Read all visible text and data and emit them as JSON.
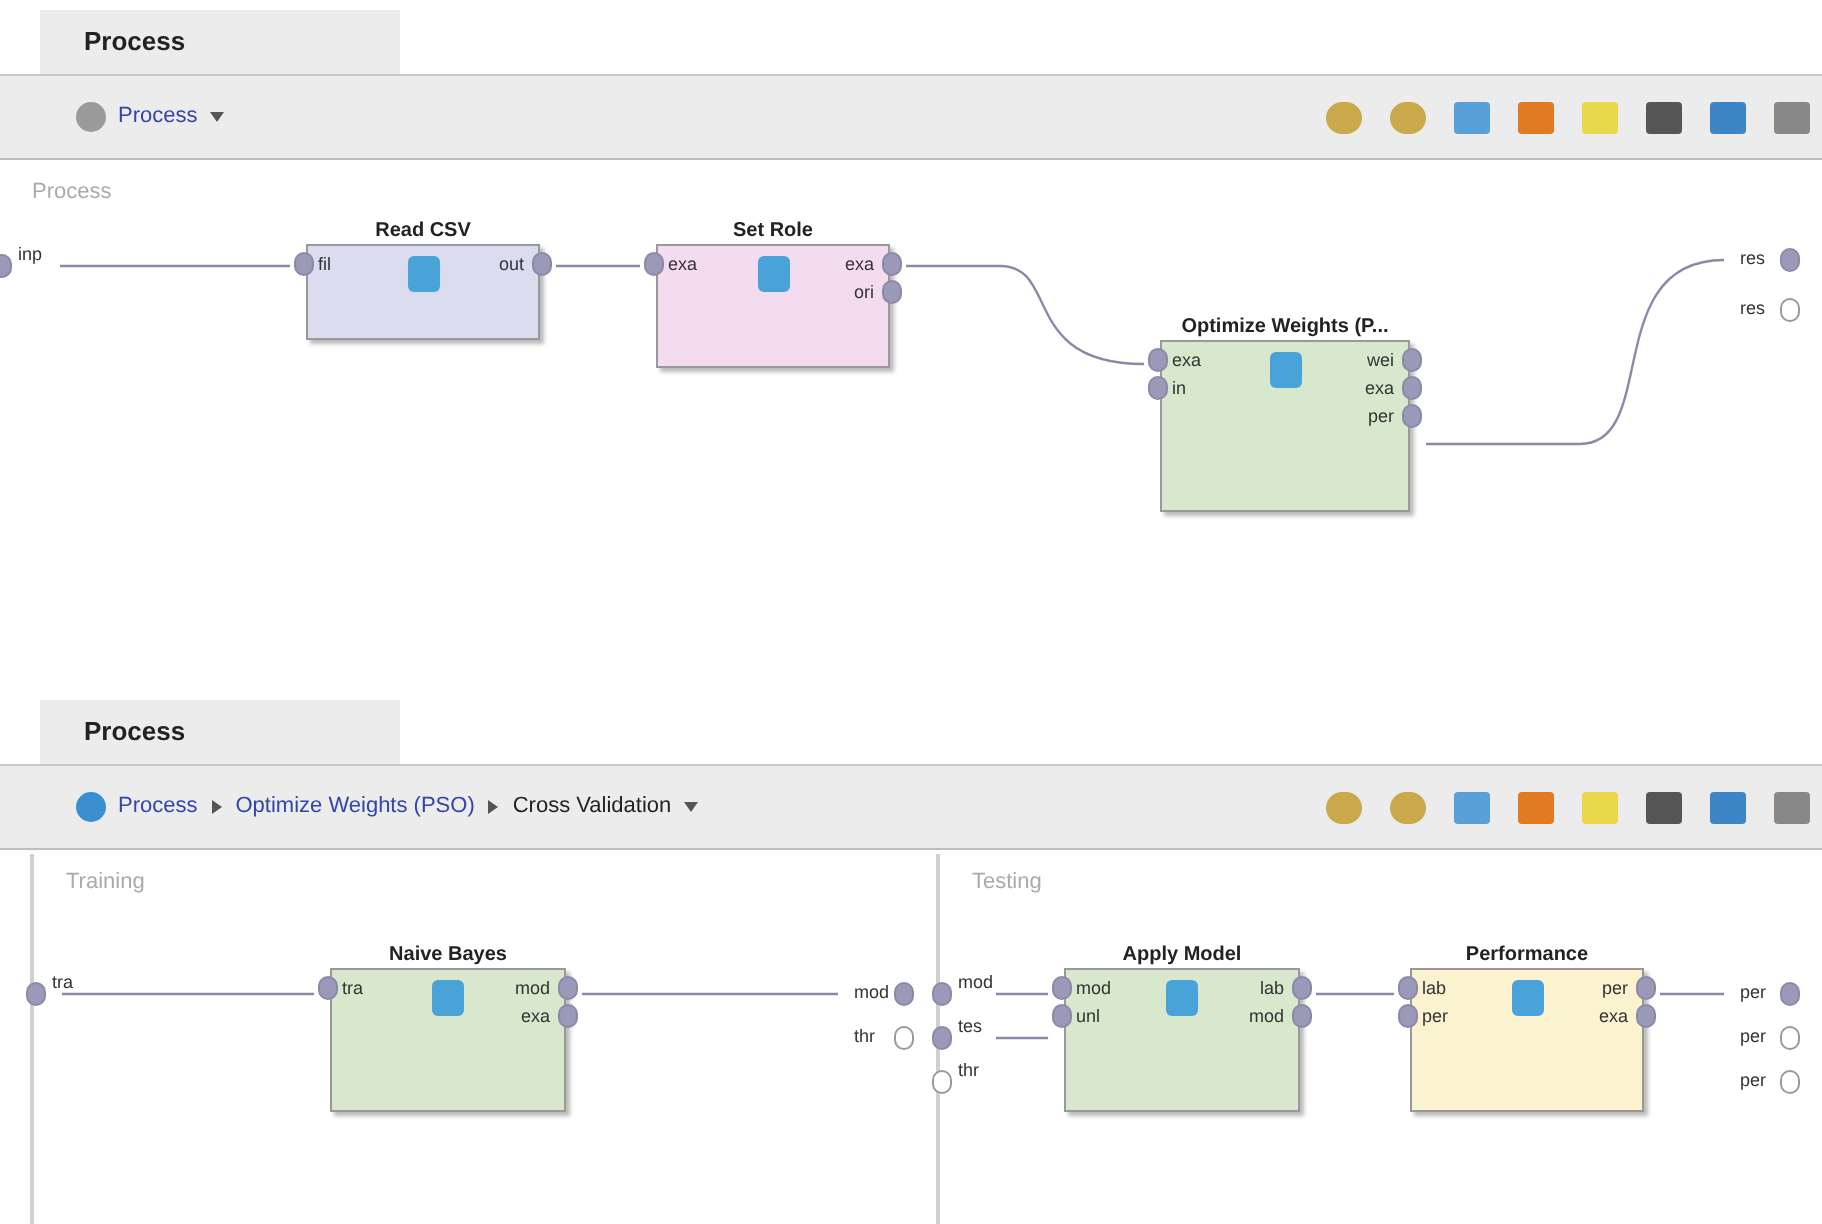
{
  "panels": [
    {
      "tab": {
        "label": "Process",
        "selected": true
      },
      "breadcrumb": [
        "Process"
      ],
      "canvases": [
        {
          "label": "Process",
          "left_ports": [
            "inp"
          ],
          "right_ports": [
            "res",
            "res"
          ],
          "nodes": [
            {
              "title": "Read CSV",
              "color": "#dcdcf0",
              "inputs": [
                "fil"
              ],
              "outputs": [
                "out"
              ]
            },
            {
              "title": "Set Role",
              "color": "#f4dcf0",
              "inputs": [
                "exa"
              ],
              "outputs": [
                "exa",
                "ori"
              ]
            },
            {
              "title": "Optimize Weights (P...",
              "color": "#d8e8cc",
              "inputs": [
                "exa",
                "in"
              ],
              "outputs": [
                "wei",
                "exa",
                "per"
              ]
            }
          ]
        }
      ]
    },
    {
      "tab": {
        "label": "Process",
        "selected": true
      },
      "breadcrumb": [
        "Process",
        "Optimize Weights (PSO)",
        "Cross Validation"
      ],
      "canvases": [
        {
          "label": "Training",
          "left_ports": [
            "tra"
          ],
          "right_ports": [
            "mod",
            "thr"
          ],
          "nodes": [
            {
              "title": "Naive Bayes",
              "color": "#d8e8cc",
              "inputs": [
                "tra"
              ],
              "outputs": [
                "mod",
                "exa"
              ]
            }
          ]
        },
        {
          "label": "Testing",
          "left_ports": [
            "mod",
            "tes",
            "thr"
          ],
          "right_ports": [
            "per",
            "per",
            "per"
          ],
          "nodes": [
            {
              "title": "Apply Model",
              "color": "#d8e8cc",
              "inputs": [
                "mod",
                "unl"
              ],
              "outputs": [
                "lab",
                "mod"
              ]
            },
            {
              "title": "Performance",
              "color": "#fbf3d0",
              "inputs": [
                "lab",
                "per"
              ],
              "outputs": [
                "per",
                "exa"
              ]
            }
          ]
        }
      ]
    }
  ]
}
